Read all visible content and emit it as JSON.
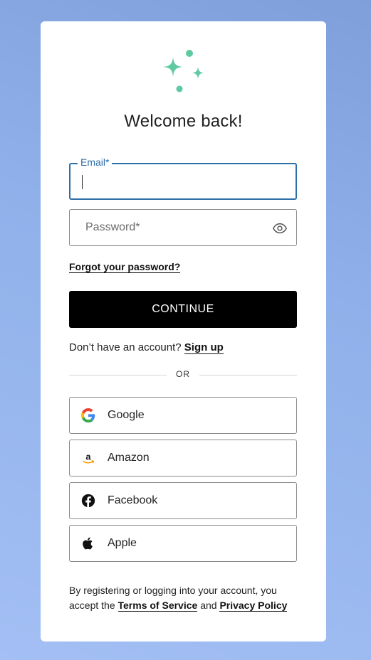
{
  "colors": {
    "accent": "#2d6fa7",
    "logo": "#5fc9a2",
    "button_bg": "#000000"
  },
  "header": {
    "title": "Welcome back!"
  },
  "form": {
    "email": {
      "label": "Email*",
      "value": ""
    },
    "password": {
      "placeholder": "Password*",
      "value": "",
      "toggle_icon": "eye-icon"
    },
    "forgot_label": "Forgot your password?",
    "continue_label": "CONTINUE"
  },
  "signup": {
    "prompt": "Don’t have an account?",
    "link_label": "Sign up"
  },
  "divider": {
    "label": "OR"
  },
  "social": [
    {
      "label": "Google",
      "icon": "google-icon"
    },
    {
      "label": "Amazon",
      "icon": "amazon-icon"
    },
    {
      "label": "Facebook",
      "icon": "facebook-icon"
    },
    {
      "label": "Apple",
      "icon": "apple-icon"
    }
  ],
  "legal": {
    "line1": "By registering or logging into your account, you accept the",
    "terms_label": "Terms of Service",
    "and": "and",
    "privacy_label": "Privacy Policy"
  }
}
